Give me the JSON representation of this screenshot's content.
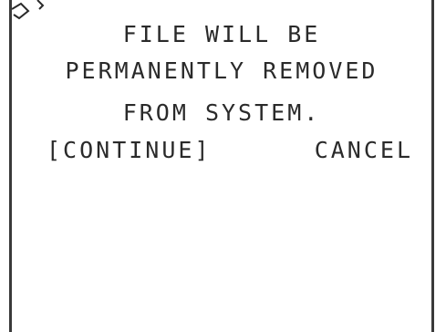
{
  "dialog": {
    "message_lines": [
      "FILE WILL BE",
      "PERMANENTLY REMOVED",
      "FROM SYSTEM."
    ],
    "continue_label": "[CONTINUE]",
    "cancel_label": "CANCEL"
  },
  "colors": {
    "text": "#2a2a2a",
    "frame": "#3a3a3a",
    "background": "#ffffff"
  }
}
